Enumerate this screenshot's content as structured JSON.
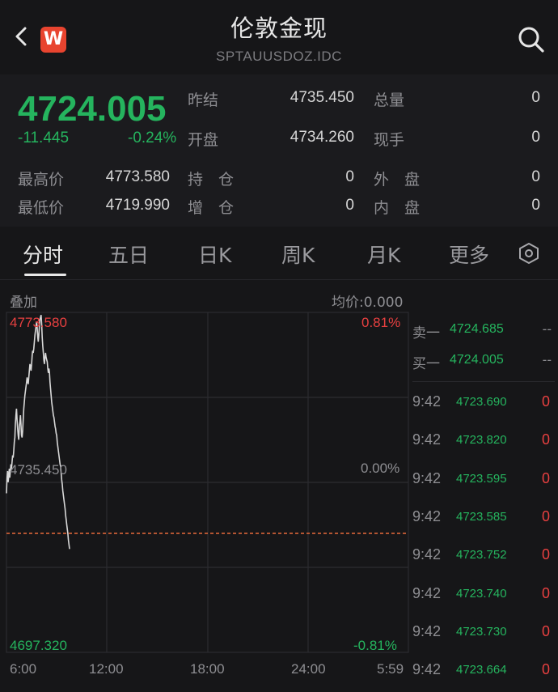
{
  "header": {
    "title": "伦敦金现",
    "subtitle": "SPTAUUSDOZ.IDC",
    "brand_letter": "W"
  },
  "quote": {
    "last_price": "4724.005",
    "change_abs": "-11.445",
    "change_pct": "-0.24%",
    "fields": {
      "prev_settle_label": "昨结",
      "prev_settle_value": "4735.450",
      "total_vol_label": "总量",
      "total_vol_value": "0",
      "open_label": "开盘",
      "open_value": "4734.260",
      "cur_hand_label": "现手",
      "cur_hand_value": "0",
      "high_label": "最高价",
      "high_value": "4773.580",
      "position_label": "持　仓",
      "position_value": "0",
      "outer_label": "外　盘",
      "outer_value": "0",
      "low_label": "最低价",
      "low_value": "4719.990",
      "increase_label": "增　仓",
      "increase_value": "0",
      "inner_label": "内　盘",
      "inner_value": "0"
    },
    "colors": {
      "down": "#25b45e",
      "up": "#e84040"
    }
  },
  "tabs": [
    {
      "label": "分时",
      "active": true
    },
    {
      "label": "五日",
      "active": false
    },
    {
      "label": "日K",
      "active": false
    },
    {
      "label": "周K",
      "active": false
    },
    {
      "label": "月K",
      "active": false
    },
    {
      "label": "更多",
      "active": false
    }
  ],
  "chart": {
    "overlay_label": "叠加",
    "avg_label": "均价:0.000",
    "y_top_price": "4773.580",
    "y_top_pct": "0.81%",
    "y_mid_price": "4735.450",
    "y_mid_pct": "0.00%",
    "y_bottom_price": "4697.320",
    "y_bottom_pct": "-0.81%",
    "x_labels": [
      "6:00",
      "12:00",
      "18:00",
      "24:00",
      "5:59"
    ]
  },
  "chart_data": {
    "type": "line",
    "ylim": [
      4697.32,
      4773.58
    ],
    "xlim": [
      0,
      1440
    ],
    "baseline": 4735.45,
    "last": 4724.005,
    "x": [
      0,
      2,
      4,
      6,
      8,
      10,
      12,
      14,
      16,
      18,
      20,
      22,
      24,
      26,
      28,
      30,
      32,
      34,
      36,
      38,
      40,
      42,
      44,
      46,
      48,
      50,
      52,
      54,
      56,
      58,
      60,
      62,
      64,
      66,
      68,
      70,
      72,
      74,
      76,
      78,
      80,
      82,
      84,
      86,
      88,
      90,
      92,
      94,
      96,
      98,
      100,
      102,
      104,
      106,
      108,
      110,
      112,
      114,
      116,
      118,
      120,
      122,
      124,
      126,
      128,
      130,
      132,
      134,
      136,
      138,
      140,
      142,
      144,
      146,
      148,
      150,
      152,
      154,
      156,
      158,
      160,
      162,
      164,
      166,
      168,
      170,
      172,
      174,
      176,
      178,
      180,
      182,
      184,
      186,
      188,
      190,
      192,
      194,
      196,
      198,
      200,
      202,
      204,
      206,
      208,
      210,
      212,
      214,
      216,
      218,
      220,
      222,
      224,
      226
    ],
    "values": [
      4733.0,
      4736.5,
      4738.0,
      4735.5,
      4737.0,
      4738.5,
      4736.5,
      4738.0,
      4739.5,
      4738.5,
      4740.0,
      4741.5,
      4741.0,
      4742.5,
      4744.5,
      4745.5,
      4748.5,
      4750.5,
      4752.0,
      4749.5,
      4747.5,
      4746.0,
      4745.0,
      4748.0,
      4749.0,
      4750.5,
      4748.5,
      4746.0,
      4745.5,
      4747.0,
      4749.5,
      4752.0,
      4753.5,
      4755.0,
      4756.0,
      4757.0,
      4758.0,
      4759.0,
      4758.0,
      4757.5,
      4759.0,
      4760.5,
      4762.0,
      4761.5,
      4760.5,
      4762.0,
      4764.0,
      4765.0,
      4764.5,
      4765.5,
      4767.0,
      4768.5,
      4769.5,
      4770.5,
      4771.5,
      4770.0,
      4768.0,
      4767.0,
      4768.5,
      4770.5,
      4772.0,
      4772.5,
      4773.0,
      4771.0,
      4768.0,
      4766.0,
      4764.5,
      4763.0,
      4762.0,
      4763.5,
      4764.5,
      4763.5,
      4763.0,
      4762.5,
      4761.0,
      4760.0,
      4761.0,
      4760.0,
      4758.0,
      4756.5,
      4755.0,
      4753.5,
      4752.5,
      4751.5,
      4750.5,
      4750.0,
      4749.0,
      4748.0,
      4747.5,
      4746.5,
      4746.0,
      4744.5,
      4743.5,
      4742.5,
      4741.5,
      4740.5,
      4739.5,
      4739.0,
      4737.5,
      4736.0,
      4735.0,
      4733.5,
      4732.5,
      4731.5,
      4730.5,
      4729.5,
      4728.0,
      4727.0,
      4726.0,
      4725.0,
      4724.0,
      4722.5,
      4721.5,
      4720.5
    ]
  },
  "orderbook": {
    "sell_label": "卖一",
    "sell_price": "4724.685",
    "sell_vol": "--",
    "buy_label": "买一",
    "buy_price": "4724.005",
    "buy_vol": "--"
  },
  "ticks": [
    {
      "time": "9:42",
      "price": "4723.690",
      "vol": "0"
    },
    {
      "time": "9:42",
      "price": "4723.820",
      "vol": "0"
    },
    {
      "time": "9:42",
      "price": "4723.595",
      "vol": "0"
    },
    {
      "time": "9:42",
      "price": "4723.585",
      "vol": "0"
    },
    {
      "time": "9:42",
      "price": "4723.752",
      "vol": "0"
    },
    {
      "time": "9:42",
      "price": "4723.740",
      "vol": "0"
    },
    {
      "time": "9:42",
      "price": "4723.730",
      "vol": "0"
    },
    {
      "time": "9:42",
      "price": "4723.664",
      "vol": "0"
    }
  ],
  "icons": {
    "back": "chevron-left-icon",
    "brand": "brand-logo-icon",
    "search": "search-icon",
    "settings": "hexagon-settings-icon"
  }
}
